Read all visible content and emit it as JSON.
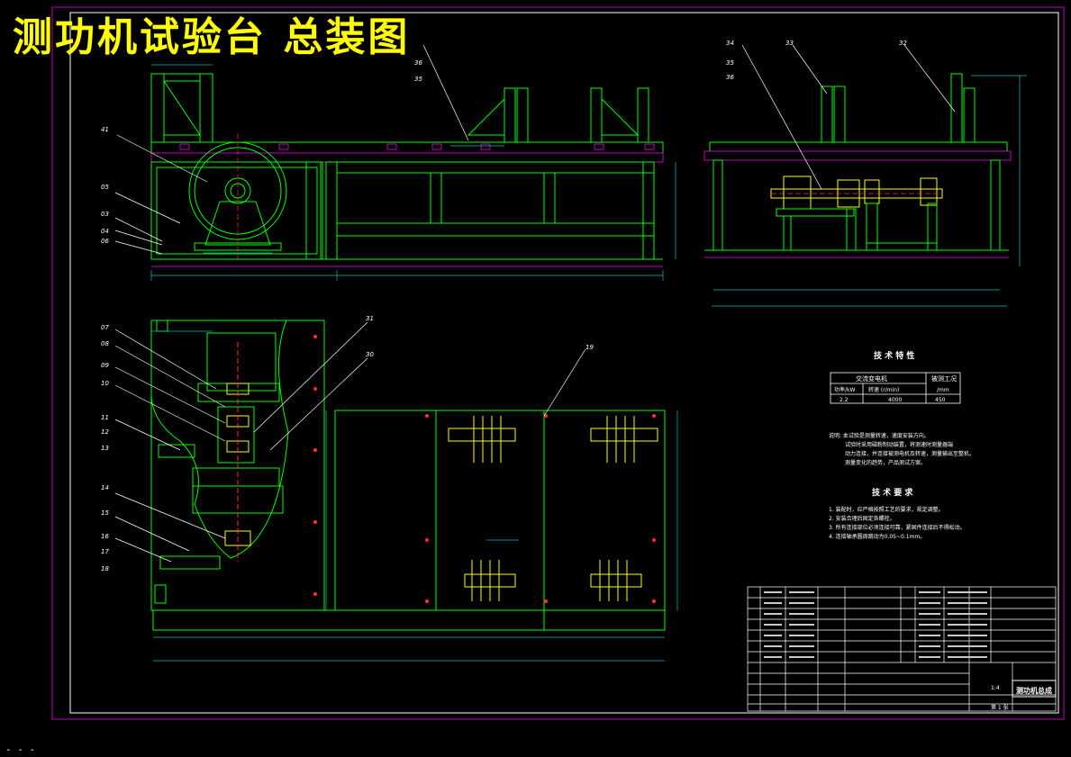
{
  "title": "测功机试验台 总装图",
  "colors": {
    "background": "#000000",
    "frame_magenta": "#c000c0",
    "geometry_green": "#00ff00",
    "dimension_cyan": "#00c0c0",
    "title_yellow": "#ffff00",
    "text_white": "#ffffff",
    "detail_red": "#ff3030"
  },
  "callouts_front_view": [
    "41",
    "05",
    "03",
    "04",
    "06"
  ],
  "callouts_side_view": [
    "34",
    "35",
    "36",
    "33",
    "32"
  ],
  "callouts_top_left": [
    "36",
    "35"
  ],
  "callouts_plan_view": [
    "07",
    "08",
    "09",
    "10",
    "11",
    "12",
    "13",
    "14",
    "15",
    "16",
    "17",
    "18",
    "31",
    "30",
    "19"
  ],
  "tech_specs": {
    "heading": "技 术 特 性",
    "table": {
      "header_left": "交流变电机",
      "header_right": "被测工况",
      "sub_1": "功率/kW",
      "sub_2": "转速 (r/min)",
      "sub_3": "/mm",
      "val_1": "2.2",
      "val_2": "4000",
      "val_3": "450"
    },
    "notes": [
      "说明: 本试验是测量转速，速度安装方向。",
      "试验时采用磁粉制动装置，将测速时测量器端",
      "动力连接，并连接被测电机及转速，测量输出至整机。",
      "测量变化的趋势，产品测试方案。"
    ]
  },
  "tech_requirements": {
    "heading": "技 术 要 求",
    "items": [
      "1. 装配时，应严格按照工艺的要求，规定调整。",
      "2. 安装合理后固定各螺栓。",
      "3. 所有连接部位必须连接可靠，紧固件连接后不得松动。",
      "4. 连接轴承圆周跳动为0.05~0.1mm。"
    ]
  },
  "title_block": {
    "drawing_name": "测功机总成",
    "scale": "1:4",
    "sheet": "第 1 张"
  },
  "bottom_mark": "- - -"
}
